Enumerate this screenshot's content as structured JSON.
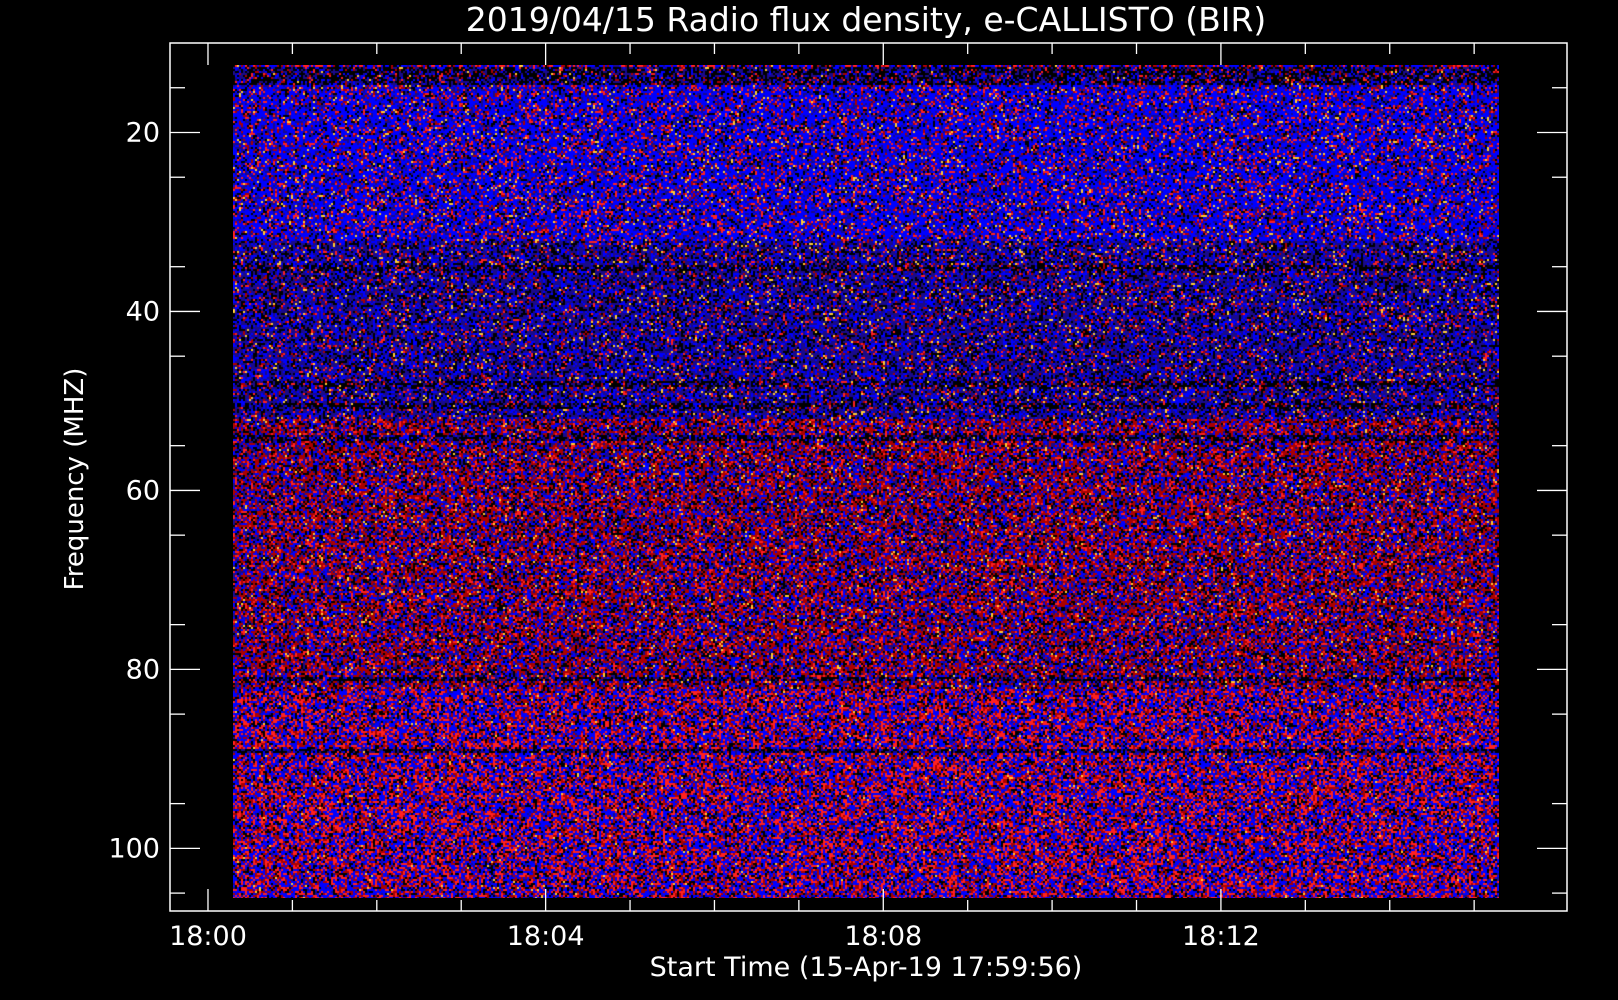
{
  "chart_data": {
    "type": "heatmap",
    "title": "2019/04/15  Radio flux density, e-CALLISTO (BIR)",
    "xlabel": "Start Time (15-Apr-19 17:59:56)",
    "ylabel": "Frequency (MHZ)",
    "x_ticks": [
      "18:00",
      "18:04",
      "18:08",
      "18:12"
    ],
    "x_tick_minutes": [
      0,
      4,
      8,
      12
    ],
    "xlim_minutes": [
      -0.45,
      16.1
    ],
    "data_x_range_minutes": [
      0.3,
      15.3
    ],
    "y_ticks": [
      20,
      40,
      60,
      80,
      100
    ],
    "ylim": [
      10,
      107
    ],
    "y_inverted": true,
    "data_y_range": [
      12.5,
      105.5
    ],
    "colormap": [
      "#000000",
      "#1a0a8a",
      "#0000ff",
      "#aa0000",
      "#ff2020",
      "#ffcc33"
    ],
    "bands": [
      {
        "freq_from": 12.5,
        "freq_to": 14.5,
        "character": "dark"
      },
      {
        "freq_from": 14.5,
        "freq_to": 32,
        "character": "blue"
      },
      {
        "freq_from": 32,
        "freq_to": 52,
        "character": "purple"
      },
      {
        "freq_from": 52,
        "freq_to": 82,
        "character": "red"
      },
      {
        "freq_from": 82,
        "freq_to": 105.5,
        "character": "mixed"
      }
    ],
    "dark_rows_mhz": [
      13,
      14,
      35,
      48,
      50.5,
      54,
      81,
      89
    ]
  }
}
